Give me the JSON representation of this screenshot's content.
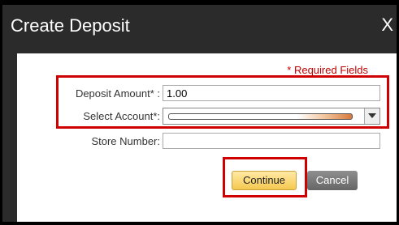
{
  "dialog": {
    "title": "Create Deposit",
    "close_label": "X"
  },
  "form": {
    "required_note": "* Required Fields",
    "deposit_amount": {
      "label": "Deposit Amount* :",
      "value": "1.00"
    },
    "select_account": {
      "label": "Select Account*:"
    },
    "store_number": {
      "label": "Store Number:",
      "value": ""
    }
  },
  "buttons": {
    "continue": "Continue",
    "cancel": "Cancel"
  },
  "colors": {
    "highlight": "#d00000",
    "continue_button": "#f6c94f",
    "cancel_button": "#777777"
  }
}
